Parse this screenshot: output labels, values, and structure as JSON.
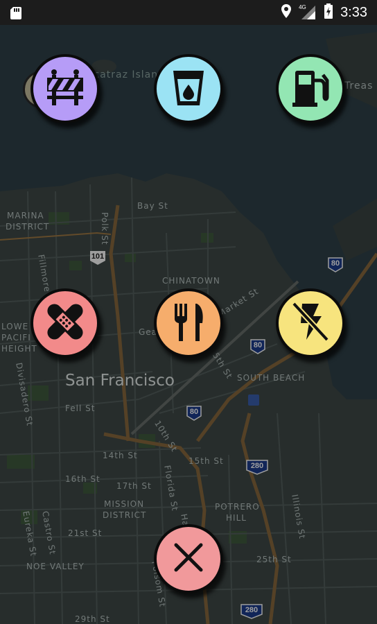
{
  "status_bar": {
    "time": "3:33",
    "network_label": "4G",
    "icons": [
      "sd-card-icon",
      "location-icon",
      "signal-icon",
      "battery-charging-icon"
    ]
  },
  "map": {
    "labels": {
      "island": "Alcatraz Island",
      "treasure": "Treas",
      "marina1": "MARINA",
      "marina2": "DISTRICT",
      "polk": "Polk St",
      "bay": "Bay St",
      "filmore": "Fillmore",
      "hwy101": "101",
      "hwy80a": "80",
      "hwy80b": "80",
      "hwy80c": "80",
      "hwy280a": "280",
      "hwy280b": "280",
      "chinatown": "CHINATOWN",
      "market": "Market St",
      "lower1": "LOWE",
      "lower2": "PACIFI",
      "lower3": "HEIGHT",
      "divisadero": "Divisadero St",
      "gea": "Gea",
      "fifth": "5th St",
      "southbeach": "SOUTH BEACH",
      "sf": "San Francisco",
      "fell": "Fell St",
      "tenth": "10th St",
      "fourteenth": "14th St",
      "fifteenth": "15th St",
      "sixteenth": "16th St",
      "seventeenth": "17th St",
      "florida": "Florida St",
      "mission1": "MISSION",
      "mission2": "DISTRICT",
      "potrero1": "POTRERO",
      "potrero2": "HILL",
      "illinois": "Illinois St",
      "eureka": "Eureka St",
      "castro": "Castro St",
      "twentyfirst": "21st St",
      "ha": "Ha",
      "noevalley": "NOE VALLEY",
      "twentyfifth": "25th St",
      "folsom": "Folsom St",
      "twentyninth": "29th St"
    }
  },
  "actions": {
    "roadblock": {
      "icon": "roadblock-icon",
      "color": "#b69cf7"
    },
    "water": {
      "icon": "water-glass-icon",
      "color": "#9be3f4"
    },
    "fuel": {
      "icon": "fuel-pump-icon",
      "color": "#93e6b3"
    },
    "first_aid": {
      "icon": "bandage-icon",
      "color": "#f28a8a"
    },
    "food": {
      "icon": "fork-knife-icon",
      "color": "#f6ad6c"
    },
    "power": {
      "icon": "no-power-icon",
      "color": "#f7e47e"
    },
    "close": {
      "icon": "close-icon",
      "color": "#f1999b"
    }
  }
}
